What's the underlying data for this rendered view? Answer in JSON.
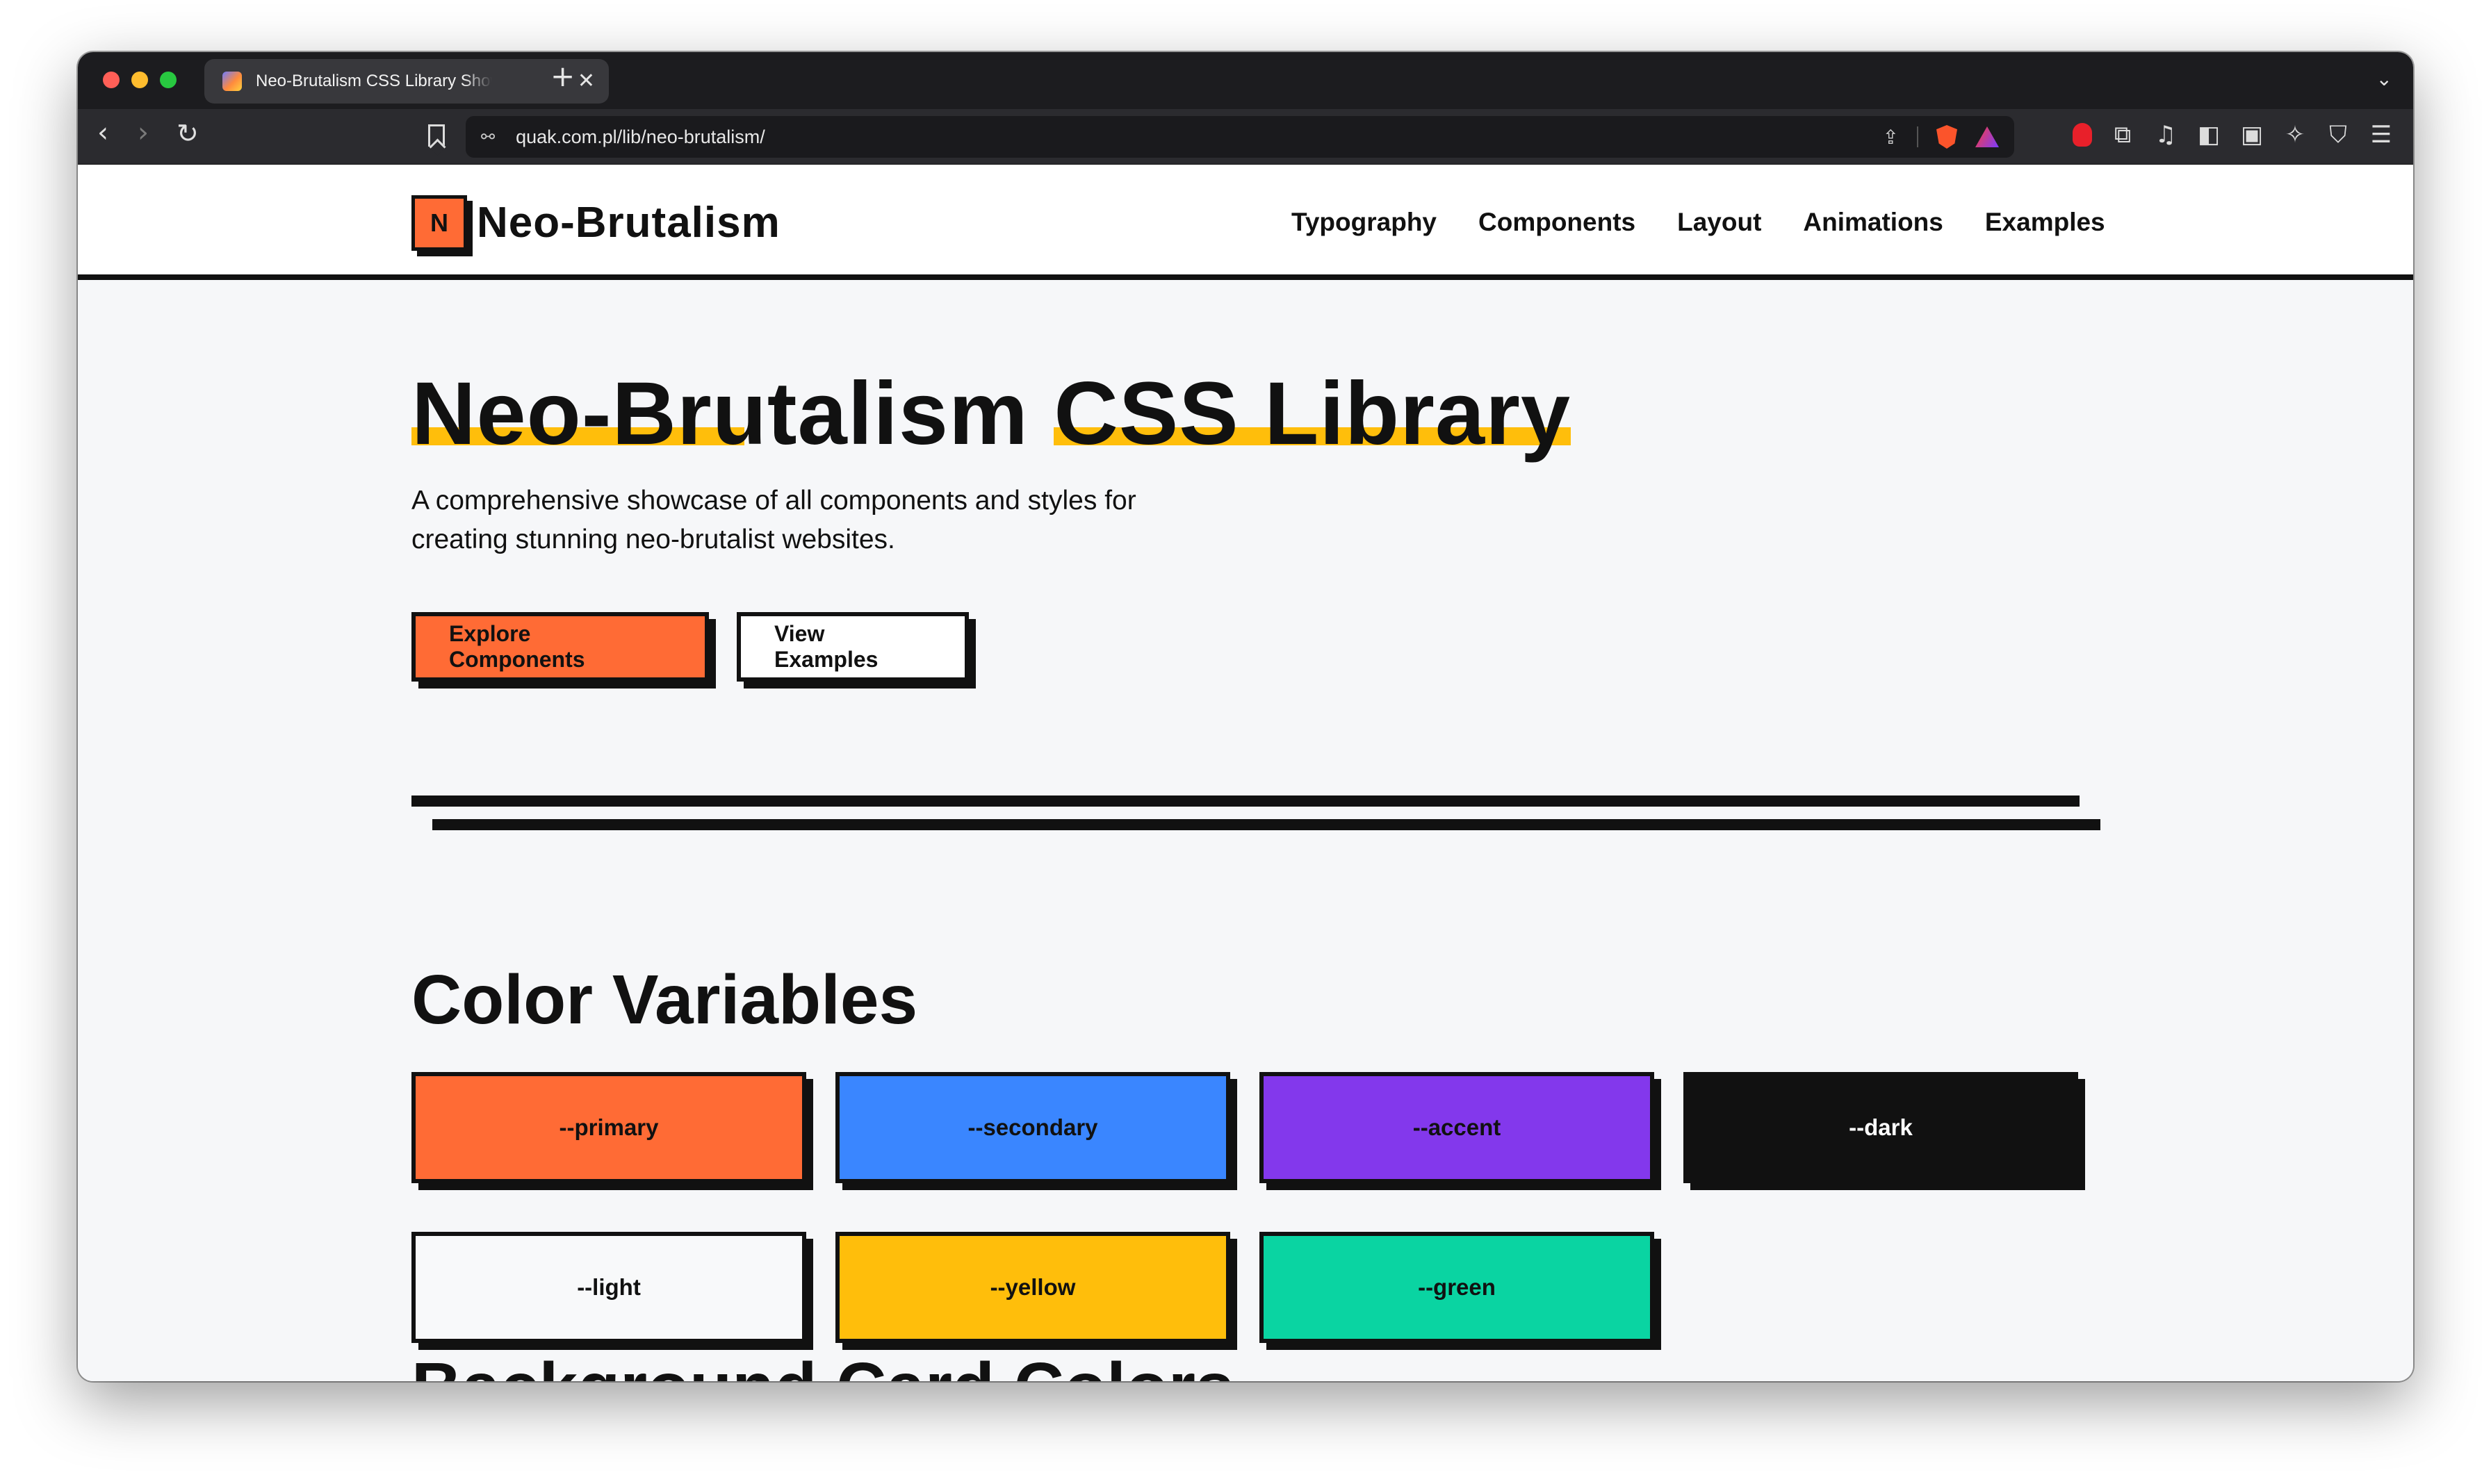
{
  "browser": {
    "tab_title": "Neo-Brutalism CSS Library Showcase",
    "tab_close": "✕",
    "new_tab": "+",
    "tab_list": "⌄",
    "url": "quak.com.pl/lib/neo-brutalism/",
    "nav_back": "‹",
    "nav_forward": "›",
    "reload": "↻",
    "tune_icon": "⚯",
    "share_icon": "⇪",
    "extensions": [
      "puzzle-icon",
      "music-icon",
      "sidebar-icon",
      "wallet-icon",
      "sparkle-icon",
      "shield-icon",
      "menu-icon"
    ]
  },
  "header": {
    "logo_letter": "N",
    "logo_text": "Neo-Brutalism",
    "nav": [
      "Typography",
      "Components",
      "Layout",
      "Animations",
      "Examples"
    ]
  },
  "hero": {
    "title_part1": "Neo-Brutalism",
    "title_part2": "CSS Library",
    "subtitle": "A comprehensive showcase of all components and styles for creating stunning neo-brutalist websites.",
    "primary_button": "Explore Components",
    "secondary_button": "View Examples"
  },
  "colors_section": {
    "title": "Color Variables",
    "swatches": [
      {
        "label": "--primary",
        "color": "#ff6b35"
      },
      {
        "label": "--secondary",
        "color": "#3a86ff"
      },
      {
        "label": "--accent",
        "color": "#8338ec"
      },
      {
        "label": "--dark",
        "color": "#111111"
      },
      {
        "label": "--light",
        "color": "#f8f9fa"
      },
      {
        "label": "--yellow",
        "color": "#ffbe0b"
      },
      {
        "label": "--green",
        "color": "#0ad4a2"
      }
    ]
  },
  "next_section": {
    "title": "Background Card Colors"
  }
}
